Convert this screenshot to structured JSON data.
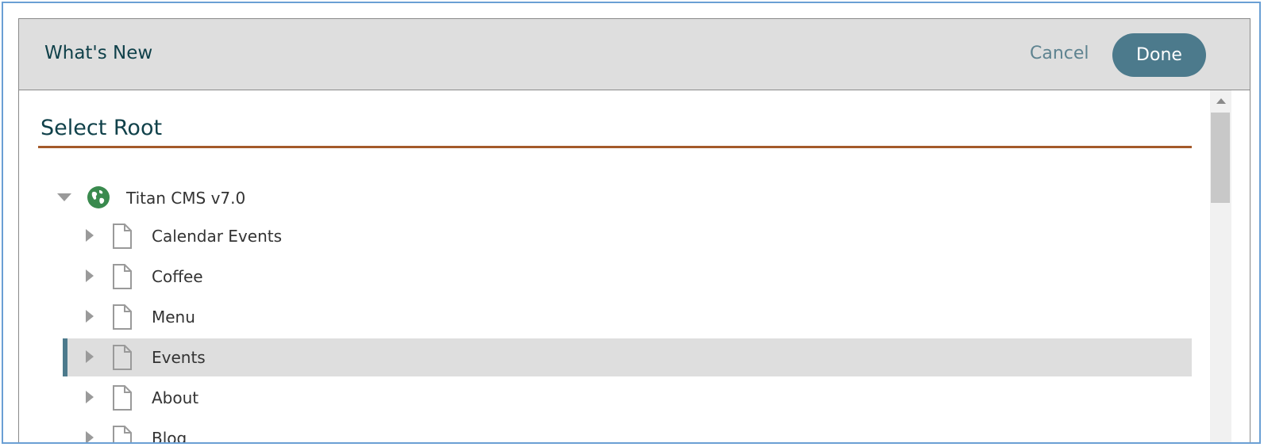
{
  "header": {
    "title": "What's New",
    "cancel_label": "Cancel",
    "done_label": "Done"
  },
  "section": {
    "title": "Select Root"
  },
  "tree": {
    "root": {
      "label": "Titan CMS v7.0",
      "icon": "globe-icon",
      "expanded": true
    },
    "children": [
      {
        "label": "Calendar Events",
        "icon": "document-icon",
        "selected": false
      },
      {
        "label": "Coffee",
        "icon": "document-icon",
        "selected": false
      },
      {
        "label": "Menu",
        "icon": "document-icon",
        "selected": false
      },
      {
        "label": "Events",
        "icon": "document-icon",
        "selected": true
      },
      {
        "label": "About",
        "icon": "document-icon",
        "selected": false
      },
      {
        "label": "Blog",
        "icon": "document-icon",
        "selected": false
      }
    ]
  },
  "colors": {
    "accent": "#4c7a8c",
    "title_text": "#10414a",
    "rule": "#a45a2a",
    "header_bg": "#dedede",
    "selected_bg": "#dedede",
    "globe": "#3a8a4e"
  }
}
